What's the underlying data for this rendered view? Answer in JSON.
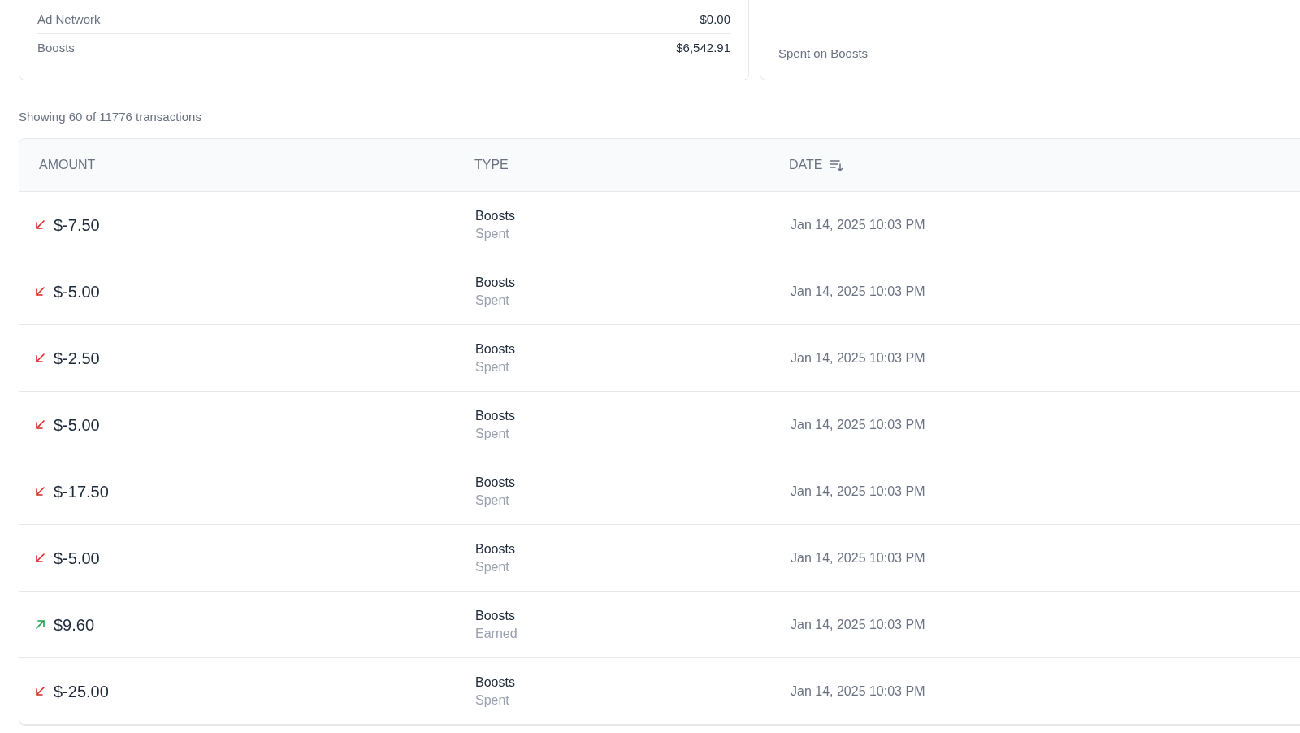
{
  "breakdown": [
    {
      "label": "Ad Network",
      "value": "$0.00"
    },
    {
      "label": "Boosts",
      "value": "$6,542.91"
    }
  ],
  "stat_card": {
    "caption": "Spent on Boosts"
  },
  "summary": "Showing 60 of 11776 transactions",
  "table": {
    "columns": [
      {
        "label": "AMOUNT",
        "sorted": false
      },
      {
        "label": "TYPE",
        "sorted": false
      },
      {
        "label": "DATE",
        "sorted": true
      }
    ],
    "rows": [
      {
        "kind": "debit",
        "amount": "$-7.50",
        "type": "Boosts",
        "subtype": "Spent",
        "date": "Jan 14, 2025 10:03 PM"
      },
      {
        "kind": "debit",
        "amount": "$-5.00",
        "type": "Boosts",
        "subtype": "Spent",
        "date": "Jan 14, 2025 10:03 PM"
      },
      {
        "kind": "debit",
        "amount": "$-2.50",
        "type": "Boosts",
        "subtype": "Spent",
        "date": "Jan 14, 2025 10:03 PM"
      },
      {
        "kind": "debit",
        "amount": "$-5.00",
        "type": "Boosts",
        "subtype": "Spent",
        "date": "Jan 14, 2025 10:03 PM"
      },
      {
        "kind": "debit",
        "amount": "$-17.50",
        "type": "Boosts",
        "subtype": "Spent",
        "date": "Jan 14, 2025 10:03 PM"
      },
      {
        "kind": "debit",
        "amount": "$-5.00",
        "type": "Boosts",
        "subtype": "Spent",
        "date": "Jan 14, 2025 10:03 PM"
      },
      {
        "kind": "credit",
        "amount": "$9.60",
        "type": "Boosts",
        "subtype": "Earned",
        "date": "Jan 14, 2025 10:03 PM"
      },
      {
        "kind": "debit",
        "amount": "$-25.00",
        "type": "Boosts",
        "subtype": "Spent",
        "date": "Jan 14, 2025 10:03 PM"
      }
    ]
  }
}
